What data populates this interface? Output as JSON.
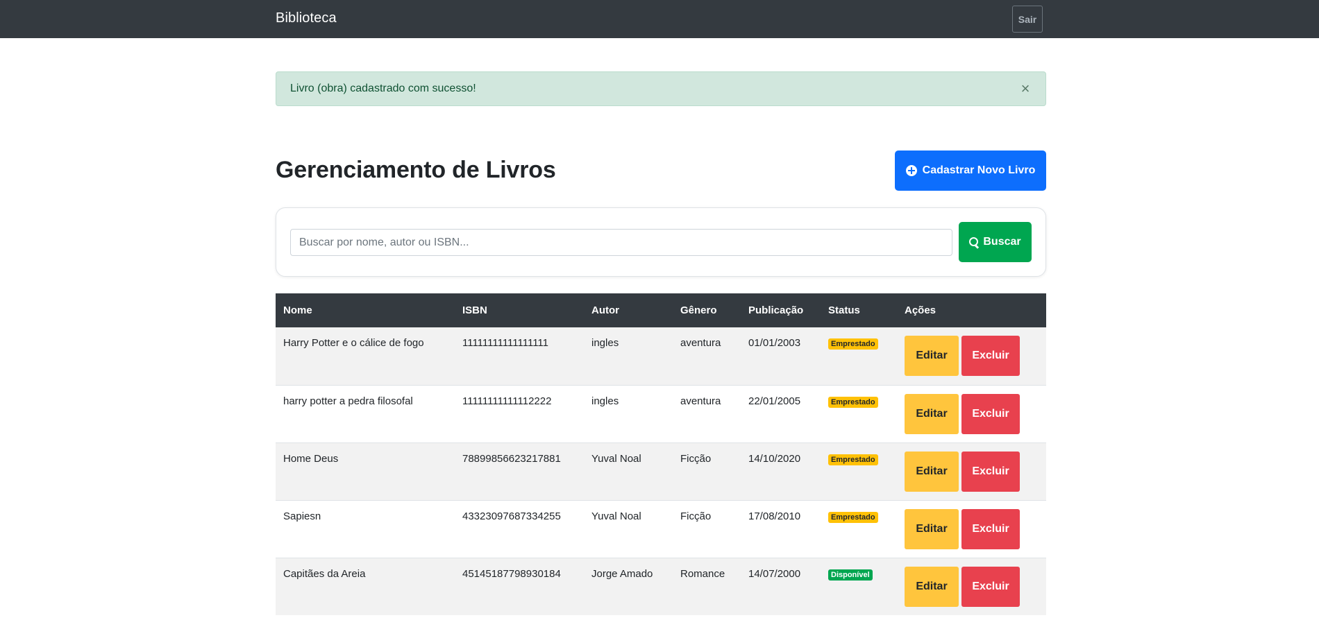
{
  "navbar": {
    "brand": "Biblioteca",
    "logout_label": "Sair",
    "background": "#343a40"
  },
  "alert": {
    "message": "Livro (obra) cadastrado com sucesso!",
    "close_icon": "close-icon",
    "background": "#d1e7dd"
  },
  "header": {
    "title": "Gerenciamento de Livros",
    "new_button_label": "Cadastrar Novo Livro",
    "new_button_icon": "plus-circle-icon",
    "accent": "#0d6efd"
  },
  "search": {
    "placeholder": "Buscar por nome, autor ou ISBN...",
    "value": "",
    "button_label": "Buscar",
    "button_icon": "search-icon",
    "button_color": "#00a650"
  },
  "table": {
    "columns": [
      "Nome",
      "ISBN",
      "Autor",
      "Gênero",
      "Publicação",
      "Status",
      "Ações"
    ],
    "rows": [
      {
        "nome": "Harry Potter e o cálice de fogo",
        "isbn": "11111111111111111",
        "autor": "ingles",
        "genero": "aventura",
        "publicacao": "01/01/2003",
        "status": "Emprestado",
        "edit": "Editar",
        "delete": "Excluir"
      },
      {
        "nome": "harry potter a pedra filosofal",
        "isbn": "11111111111112222",
        "autor": "ingles",
        "genero": "aventura",
        "publicacao": "22/01/2005",
        "status": "Emprestado",
        "edit": "Editar",
        "delete": "Excluir"
      },
      {
        "nome": "Home Deus",
        "isbn": "78899856623217881",
        "autor": "Yuval Noal",
        "genero": "Ficção",
        "publicacao": "14/10/2020",
        "status": "Emprestado",
        "edit": "Editar",
        "delete": "Excluir"
      },
      {
        "nome": "Sapiesn",
        "isbn": "43323097687334255",
        "autor": "Yuval Noal",
        "genero": "Ficção",
        "publicacao": "17/08/2010",
        "status": "Emprestado",
        "edit": "Editar",
        "delete": "Excluir"
      },
      {
        "nome": "Capitães da Areia",
        "isbn": "45145187798930184",
        "autor": "Jorge Amado",
        "genero": "Romance",
        "publicacao": "14/07/2000",
        "status": "Disponível",
        "edit": "Editar",
        "delete": "Excluir"
      }
    ],
    "status_colors": {
      "Emprestado": "#ffc107",
      "Disponível": "#00a650"
    },
    "edit_color": "#ffc53d",
    "delete_color": "#e8414e"
  }
}
